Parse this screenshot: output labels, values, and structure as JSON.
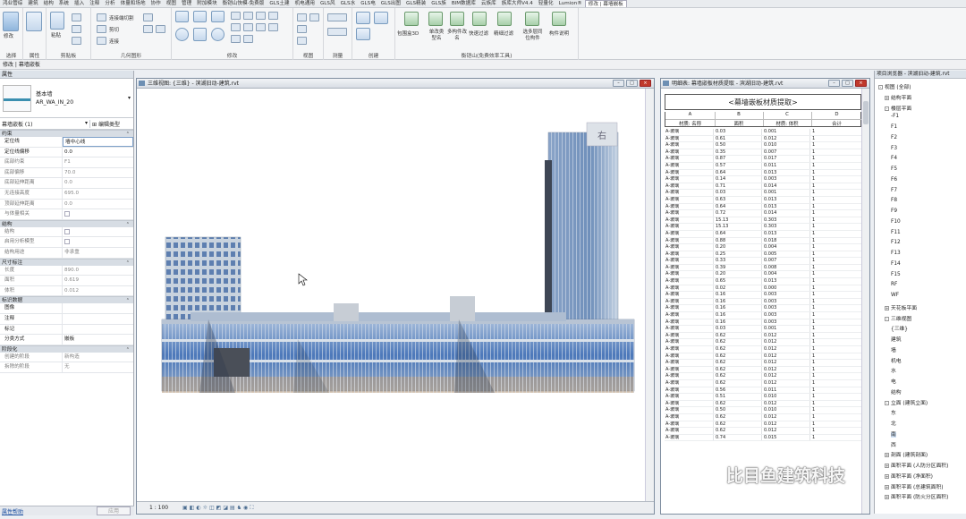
{
  "tabs": [
    "鸿业管综",
    "建筑",
    "结构",
    "系统",
    "插入",
    "注释",
    "分析",
    "体量和场地",
    "协作",
    "视图",
    "管理",
    "附加模块",
    "衡铠山快模-免费版",
    "GLS土建",
    "机电通用",
    "GLS风",
    "GLS水",
    "GLS电",
    "GLS出图",
    "GLS精装",
    "GLS族",
    "BIM数据库",
    "云族库",
    "族库大师V4.4",
    "轻量化",
    "Lumion®",
    "修改 | 幕墙嵌板"
  ],
  "ribbon": {
    "groups": [
      "选择",
      "属性",
      "剪贴板",
      "几何图形",
      "修改",
      "视图",
      "测量",
      "创建",
      "衡铠山(免费效率工具)"
    ],
    "labels": {
      "modify": "修改",
      "paste": "粘贴",
      "join_cut": "连接端切割",
      "cut": "剪切",
      "join": "连接",
      "tool_bbox": "包围盒3D",
      "tool_single_type": "单改类型名",
      "tool_multi_type": "多构件改名",
      "tool_quick_filter": "快速过滤",
      "tool_precise_filter": "精细过滤",
      "tool_select_layers": "选多层同位构件",
      "tool_member_desc": "构件说明"
    }
  },
  "subbar": "修改 | 幕墙嵌板",
  "properties": {
    "panel_title": "属性",
    "family": "基本墙",
    "type": "AR_WA_IN_20",
    "selector": "幕墙嵌板 (1)",
    "edit_type": "编辑类型",
    "sections": [
      {
        "name": "约束",
        "rows": [
          [
            "定位线",
            "墙中心线",
            1
          ],
          [
            "定位线偏移",
            "0.0",
            1
          ],
          [
            "底部约束",
            "F1",
            0
          ],
          [
            "底部偏移",
            "70.0",
            0
          ],
          [
            "底部延伸距离",
            "0.0",
            0
          ],
          [
            "无连接高度",
            "695.0",
            0
          ],
          [
            "顶部延伸距离",
            "0.0",
            0
          ],
          [
            "与体量相关",
            "[]",
            0
          ]
        ]
      },
      {
        "name": "结构",
        "rows": [
          [
            "结构",
            "[]",
            0
          ],
          [
            "启用分析模型",
            "[]",
            0
          ],
          [
            "结构用途",
            "非承重",
            0
          ]
        ]
      },
      {
        "name": "尺寸标注",
        "rows": [
          [
            "长度",
            "890.0",
            0
          ],
          [
            "面积",
            "0.619",
            0
          ],
          [
            "体积",
            "0.012",
            0
          ]
        ]
      },
      {
        "name": "标识数据",
        "rows": [
          [
            "图像",
            "",
            1
          ],
          [
            "注释",
            "",
            1
          ],
          [
            "标记",
            "",
            1
          ],
          [
            "分类方式",
            "嵌板",
            1
          ]
        ]
      },
      {
        "name": "阶段化",
        "rows": [
          [
            "创建的阶段",
            "新构造",
            0
          ],
          [
            "拆除的阶段",
            "无",
            0
          ]
        ]
      }
    ],
    "help_link": "属性帮助",
    "apply": "应用"
  },
  "view": {
    "title": "三维视图: {三维} - 滨湖旧动-建筑.rvt",
    "scale": "1 : 100",
    "viewcube": "右"
  },
  "schedule": {
    "window_title": "明细表: 幕墙嵌板材质提取 - 滨湖旧动-建筑.rvt",
    "title": "<幕墙嵌板材质提取>",
    "col_letters": [
      "A",
      "B",
      "C",
      "D"
    ],
    "col_names": [
      "材质: 名称",
      "面积",
      "材质: 体积",
      "合计"
    ],
    "rows": [
      [
        "A-玻璃",
        "0.03",
        "0.001",
        "1"
      ],
      [
        "A-玻璃",
        "0.61",
        "0.012",
        "1"
      ],
      [
        "A-玻璃",
        "0.50",
        "0.010",
        "1"
      ],
      [
        "A-玻璃",
        "0.35",
        "0.007",
        "1"
      ],
      [
        "A-玻璃",
        "0.87",
        "0.017",
        "1"
      ],
      [
        "A-玻璃",
        "0.57",
        "0.011",
        "1"
      ],
      [
        "A-玻璃",
        "0.64",
        "0.013",
        "1"
      ],
      [
        "A-玻璃",
        "0.14",
        "0.003",
        "1"
      ],
      [
        "A-玻璃",
        "0.71",
        "0.014",
        "1"
      ],
      [
        "A-玻璃",
        "0.03",
        "0.001",
        "1"
      ],
      [
        "A-玻璃",
        "0.63",
        "0.013",
        "1"
      ],
      [
        "A-玻璃",
        "0.64",
        "0.013",
        "1"
      ],
      [
        "A-玻璃",
        "0.72",
        "0.014",
        "1"
      ],
      [
        "A-玻璃",
        "15.13",
        "0.303",
        "1"
      ],
      [
        "A-玻璃",
        "15.13",
        "0.303",
        "1"
      ],
      [
        "A-玻璃",
        "0.64",
        "0.013",
        "1"
      ],
      [
        "A-玻璃",
        "0.88",
        "0.018",
        "1"
      ],
      [
        "A-玻璃",
        "0.20",
        "0.004",
        "1"
      ],
      [
        "A-玻璃",
        "0.25",
        "0.005",
        "1"
      ],
      [
        "A-玻璃",
        "0.33",
        "0.007",
        "1"
      ],
      [
        "A-玻璃",
        "0.39",
        "0.008",
        "1"
      ],
      [
        "A-玻璃",
        "0.20",
        "0.004",
        "1"
      ],
      [
        "A-玻璃",
        "0.65",
        "0.013",
        "1"
      ],
      [
        "A-玻璃",
        "0.02",
        "0.000",
        "1"
      ],
      [
        "A-玻璃",
        "0.16",
        "0.003",
        "1"
      ],
      [
        "A-玻璃",
        "0.16",
        "0.003",
        "1"
      ],
      [
        "A-玻璃",
        "0.16",
        "0.003",
        "1"
      ],
      [
        "A-玻璃",
        "0.16",
        "0.003",
        "1"
      ],
      [
        "A-玻璃",
        "0.16",
        "0.003",
        "1"
      ],
      [
        "A-玻璃",
        "0.03",
        "0.001",
        "1"
      ],
      [
        "A-玻璃",
        "0.62",
        "0.012",
        "1"
      ],
      [
        "A-玻璃",
        "0.62",
        "0.012",
        "1"
      ],
      [
        "A-玻璃",
        "0.62",
        "0.012",
        "1"
      ],
      [
        "A-玻璃",
        "0.62",
        "0.012",
        "1"
      ],
      [
        "A-玻璃",
        "0.62",
        "0.012",
        "1"
      ],
      [
        "A-玻璃",
        "0.62",
        "0.012",
        "1"
      ],
      [
        "A-玻璃",
        "0.62",
        "0.012",
        "1"
      ],
      [
        "A-玻璃",
        "0.62",
        "0.012",
        "1"
      ],
      [
        "A-玻璃",
        "0.56",
        "0.011",
        "1"
      ],
      [
        "A-玻璃",
        "0.51",
        "0.010",
        "1"
      ],
      [
        "A-玻璃",
        "0.62",
        "0.012",
        "1"
      ],
      [
        "A-玻璃",
        "0.50",
        "0.010",
        "1"
      ],
      [
        "A-玻璃",
        "0.62",
        "0.012",
        "1"
      ],
      [
        "A-玻璃",
        "0.62",
        "0.012",
        "1"
      ],
      [
        "A-玻璃",
        "0.62",
        "0.012",
        "1"
      ],
      [
        "A-玻璃",
        "0.74",
        "0.015",
        "1"
      ]
    ]
  },
  "browser": {
    "title": "项目浏览器 - 滨湖旧动-建筑.rvt",
    "nodes": [
      {
        "t": "视图 (全部)",
        "l": 0,
        "e": "-"
      },
      {
        "t": "结构平面",
        "l": 1,
        "e": "+"
      },
      {
        "t": "楼层平面",
        "l": 1,
        "e": "-"
      },
      {
        "t": "-F1",
        "l": 2
      },
      {
        "t": "F1",
        "l": 2
      },
      {
        "t": "F2",
        "l": 2
      },
      {
        "t": "F3",
        "l": 2
      },
      {
        "t": "F4",
        "l": 2
      },
      {
        "t": "F5",
        "l": 2
      },
      {
        "t": "F6",
        "l": 2
      },
      {
        "t": "F7",
        "l": 2
      },
      {
        "t": "F8",
        "l": 2
      },
      {
        "t": "F9",
        "l": 2
      },
      {
        "t": "F10",
        "l": 2
      },
      {
        "t": "F11",
        "l": 2
      },
      {
        "t": "F12",
        "l": 2
      },
      {
        "t": "F13",
        "l": 2
      },
      {
        "t": "F14",
        "l": 2
      },
      {
        "t": "F15",
        "l": 2
      },
      {
        "t": "RF",
        "l": 2
      },
      {
        "t": "WF",
        "l": 2
      },
      {
        "t": "天花板平面",
        "l": 1,
        "e": "+"
      },
      {
        "t": "三维视图",
        "l": 1,
        "e": "-"
      },
      {
        "t": "{三维}",
        "l": 2
      },
      {
        "t": "建筑",
        "l": 2
      },
      {
        "t": "墙",
        "l": 2
      },
      {
        "t": "机电",
        "l": 2
      },
      {
        "t": "水",
        "l": 2
      },
      {
        "t": "电",
        "l": 2
      },
      {
        "t": "结构",
        "l": 2
      },
      {
        "t": "立面 (建筑立面)",
        "l": 1,
        "e": "-"
      },
      {
        "t": "东",
        "l": 2
      },
      {
        "t": "北",
        "l": 2
      },
      {
        "t": "南",
        "l": 2
      },
      {
        "t": "西",
        "l": 2
      },
      {
        "t": "剖面 (建筑剖面)",
        "l": 1,
        "e": "+"
      },
      {
        "t": "面积平面 (人防分区面积)",
        "l": 1,
        "e": "+"
      },
      {
        "t": "面积平面 (净面积)",
        "l": 1,
        "e": "+"
      },
      {
        "t": "面积平面 (总建筑面积)",
        "l": 1,
        "e": "+"
      },
      {
        "t": "面积平面 (防火分区面积)",
        "l": 1,
        "e": "+"
      }
    ]
  },
  "watermark": "比目鱼建筑科技"
}
